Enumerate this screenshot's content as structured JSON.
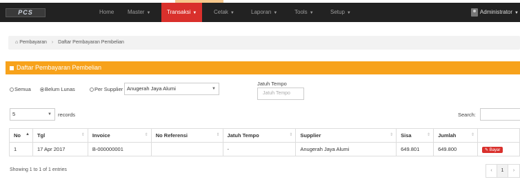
{
  "nav": {
    "logo": "PCS",
    "items": [
      "Home",
      "Master",
      "Transaksi",
      "Cetak",
      "Laporan",
      "Tools",
      "Setup"
    ],
    "active_index": 2,
    "user": "Administrator",
    "active_color": "#d9302c"
  },
  "breadcrumb": [
    "Pembayaran",
    "Daftar Pembayaran Pembelian"
  ],
  "panel": {
    "title": "Daftar Pembayaran Pembelian",
    "color": "#f7a21b"
  },
  "filters": {
    "radio_semua": "Semua",
    "radio_belum_lunas": "Belum Lunas",
    "radio_per_supplier": "Per Supplier",
    "supplier_selected": "Anugerah Jaya Alumi",
    "jatuh_tempo_label": "Jatuh Tempo",
    "jatuh_tempo_placeholder": "Jatuh Tempo"
  },
  "length": {
    "value": "5",
    "suffix": "records"
  },
  "search": {
    "label": "Search:"
  },
  "table": {
    "columns": [
      "No",
      "Tgl",
      "Invoice",
      "No Referensi",
      "Jatuh Tempo",
      "Supplier",
      "Sisa",
      "Jumlah",
      ""
    ],
    "rows": [
      [
        "1",
        "17 Apr 2017",
        "B-000000001",
        "",
        "-",
        "Anugerah Jaya Alumi",
        "649.801",
        "649.800"
      ]
    ],
    "action_label": "Bayar"
  },
  "footer": {
    "showing": "Showing 1 to 1 of 1 entries",
    "pager": [
      "‹",
      "1",
      "›"
    ]
  }
}
